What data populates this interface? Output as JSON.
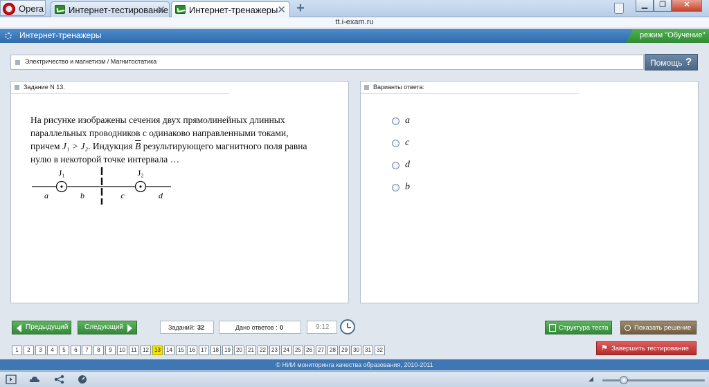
{
  "browser": {
    "menu_label": "Opera",
    "tabs": [
      {
        "label": "Интернет-тестирование"
      },
      {
        "label": "Интернет-тренажеры"
      }
    ],
    "address": "tt.i-exam.ru"
  },
  "header": {
    "title": "Интернет-тренажеры",
    "mode": "режим \"Обучение\""
  },
  "breadcrumb": "Электричество и магнетизм / Магнитостатика",
  "help": {
    "label": "Помощь",
    "icon": "?"
  },
  "task": {
    "heading": "Задание N 13.",
    "text_line1": "На рисунке изображены сечения двух прямолинейных длинных",
    "text_line2": "параллельных проводников с одинаково направленными токами,",
    "text_line3a": "причем",
    "text_formula": "J₁ > J₂",
    "text_line3b": ". Индукция",
    "text_vector": "B",
    "text_line3c": "результирующего магнитного поля равна",
    "text_line4": "нулю в некоторой точке интервала …",
    "diagram": {
      "label_j1": "J₁",
      "label_j2": "J₂",
      "regions": [
        "a",
        "b",
        "c",
        "d"
      ]
    }
  },
  "answers": {
    "heading": "Варианты ответа:",
    "options": [
      "a",
      "c",
      "d",
      "b"
    ]
  },
  "nav": {
    "prev_label": "Предыдущий",
    "next_label": "Следующий",
    "total_label": "Заданий:",
    "total_value": "32",
    "answered_label": "Дано ответов :",
    "answered_value": "0",
    "time": "9:12"
  },
  "actions": {
    "structure_label": "Структура теста",
    "show_solution_label": "Показать решение",
    "finish_label": "Завершить тестирование"
  },
  "pages": [
    "1",
    "2",
    "3",
    "4",
    "5",
    "6",
    "7",
    "8",
    "9",
    "10",
    "11",
    "12",
    "13",
    "14",
    "15",
    "16",
    "17",
    "18",
    "19",
    "20",
    "21",
    "22",
    "23",
    "24",
    "25",
    "26",
    "27",
    "28",
    "29",
    "30",
    "31",
    "32"
  ],
  "current_page": "13",
  "footer": "© НИИ мониторинга качества образования, 2010-2011",
  "colors": {
    "header_blue": "#3a7bbd",
    "mode_green": "#3f9e42",
    "nav_green": "#46a04b",
    "finish_red": "#c83b3b",
    "current_page_yellow": "#f2e400"
  }
}
